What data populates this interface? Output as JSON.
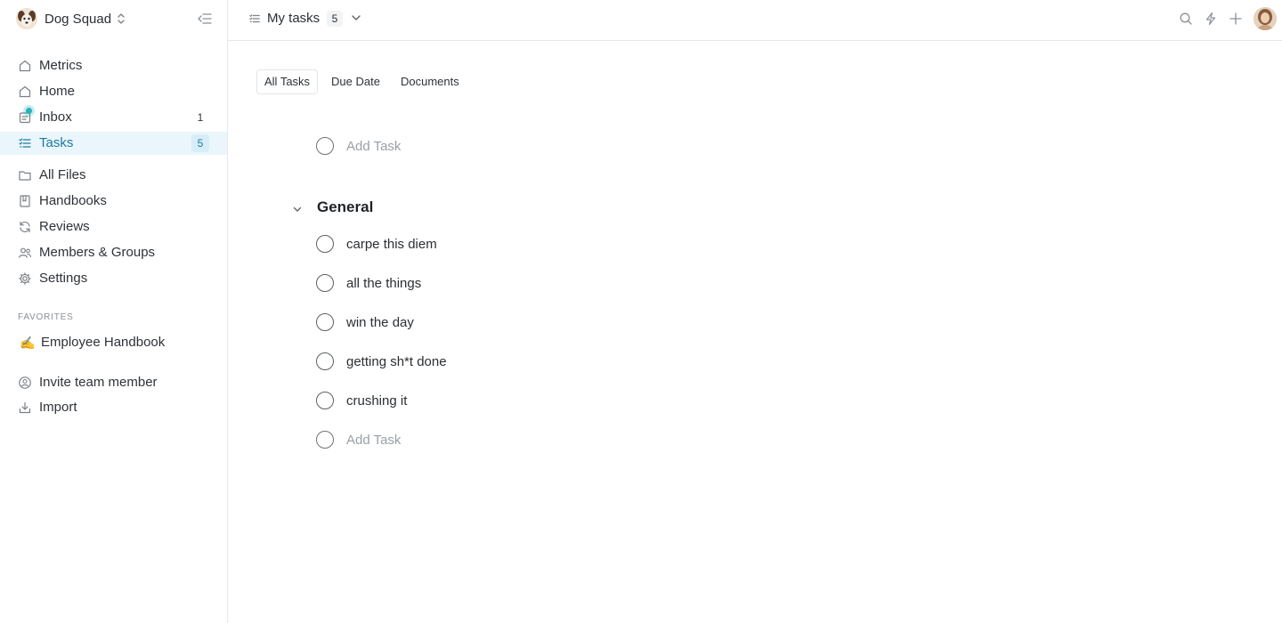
{
  "workspace": {
    "name": "Dog Squad"
  },
  "nav": {
    "primary": [
      {
        "id": "metrics",
        "label": "Metrics",
        "icon": "home-icon"
      },
      {
        "id": "home",
        "label": "Home",
        "icon": "home-icon"
      },
      {
        "id": "inbox",
        "label": "Inbox",
        "icon": "inbox-icon",
        "count": "1"
      },
      {
        "id": "tasks",
        "label": "Tasks",
        "icon": "tasks-icon",
        "count": "5",
        "active": true
      }
    ],
    "secondary": [
      {
        "id": "all-files",
        "label": "All Files",
        "icon": "folder-icon"
      },
      {
        "id": "handbooks",
        "label": "Handbooks",
        "icon": "book-icon"
      },
      {
        "id": "reviews",
        "label": "Reviews",
        "icon": "refresh-icon"
      },
      {
        "id": "members",
        "label": "Members & Groups",
        "icon": "users-icon"
      },
      {
        "id": "settings",
        "label": "Settings",
        "icon": "gear-icon"
      }
    ],
    "favorites_label": "FAVORITES",
    "favorites": [
      {
        "label": "Employee Handbook",
        "emoji": "✍️"
      }
    ],
    "footer": [
      {
        "label": "Invite team member",
        "icon": "invite-user-icon"
      },
      {
        "label": "Import",
        "icon": "import-icon"
      }
    ]
  },
  "topbar": {
    "title": "My tasks",
    "count": "5"
  },
  "tabs": [
    {
      "label": "All Tasks",
      "active": true
    },
    {
      "label": "Due Date"
    },
    {
      "label": "Documents"
    }
  ],
  "tasks": {
    "add_placeholder": "Add Task",
    "group": {
      "title": "General",
      "items": [
        "carpe this diem",
        "all the things",
        "win the day",
        "getting sh*t done",
        "crushing it"
      ],
      "add_placeholder": "Add Task"
    }
  },
  "colors": {
    "accent": "#1f7aa3",
    "active_bg": "#eaf6fb",
    "inbox_dot": "#27b3b8",
    "border": "#e8e9eb"
  }
}
